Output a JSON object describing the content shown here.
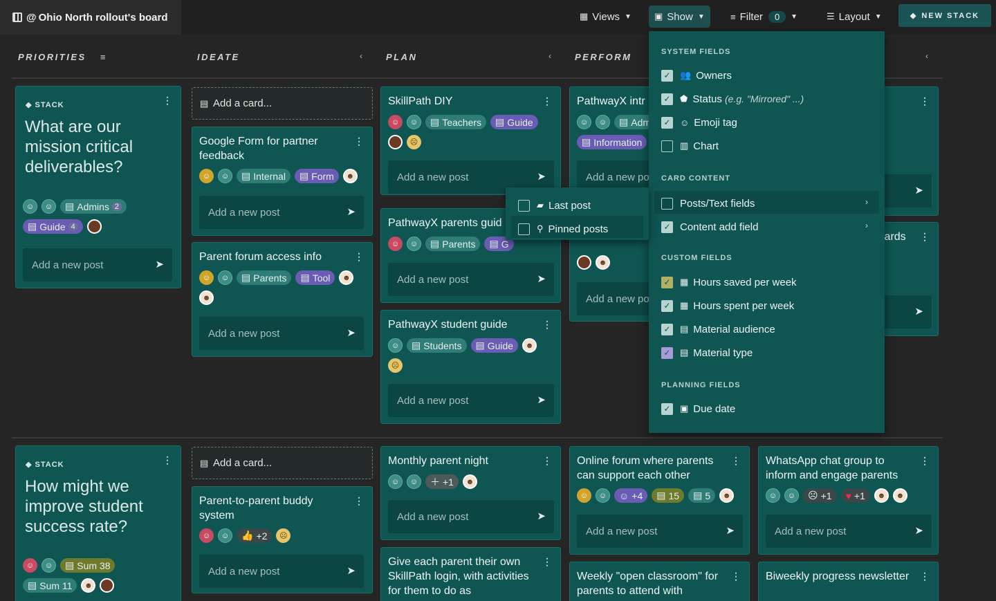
{
  "board": {
    "title": "Ohio North rollout's board"
  },
  "topbar": {
    "views": "Views",
    "show": "Show",
    "filter": "Filter",
    "filter_count": "0",
    "layout": "Layout",
    "new_stack": "NEW STACK"
  },
  "columns": {
    "priorities": "PRIORITIES",
    "ideate": "IDEATE",
    "plan": "PLAN",
    "perform": "PERFORM"
  },
  "common": {
    "add_card": "Add a card...",
    "add_post": "Add a new post",
    "add_post_trunc": "Add a new po",
    "stack_label": "STACK"
  },
  "stacks": [
    {
      "title": "What are our mission critical deliverables?",
      "admins": "Admins",
      "admins_count": "2",
      "guide": "Guide",
      "guide_count": "4"
    },
    {
      "title": "How might we improve student success rate?",
      "sum1": "Sum 38",
      "sum2": "Sum 11"
    }
  ],
  "cards": {
    "google_form": {
      "title": "Google Form for partner feedback",
      "tag1": "Internal",
      "tag2": "Form"
    },
    "parent_forum": {
      "title": "Parent forum access info",
      "tag1": "Parents",
      "tag2": "Tool"
    },
    "skillpath": {
      "title": "SkillPath DIY",
      "tag1": "Teachers",
      "tag2": "Guide"
    },
    "pw_parents": {
      "title": "PathwayX parents guid",
      "tag1": "Parents",
      "tag2": "G"
    },
    "pw_student": {
      "title": "PathwayX student guide",
      "tag1": "Students",
      "tag2": "Guide"
    },
    "pw_intro": {
      "title": "PathwayX intr",
      "tag1": "Adm",
      "tag2": "Information"
    },
    "right_card": {
      "title": "lards"
    },
    "buddy": {
      "title": "Parent-to-parent buddy system",
      "plus": "+2"
    },
    "monthly": {
      "title": "Monthly parent night",
      "plus": "+1"
    },
    "give_each": {
      "title": "Give each parent their own SkillPath login, with activities for them to do as"
    },
    "online_forum": {
      "title": "Online forum where parents can support each other",
      "plus": "+4",
      "n1": "15",
      "n2": "5"
    },
    "whatsapp": {
      "title": "WhatsApp chat group to inform and engage parents",
      "plus1": "+1",
      "plus2": "+1"
    },
    "weekly": {
      "title": "Weekly \"open classroom\" for parents to attend with"
    },
    "biweekly": {
      "title": "Biweekly progress newsletter"
    }
  },
  "show_menu": {
    "system_fields": "SYSTEM FIELDS",
    "owners": "Owners",
    "status": "Status",
    "status_hint": "(e.g. \"Mirrored\" ...)",
    "emoji_tag": "Emoji tag",
    "chart": "Chart",
    "card_content": "CARD CONTENT",
    "posts_text": "Posts/Text fields",
    "content_add": "Content add field",
    "custom_fields": "CUSTOM FIELDS",
    "hours_saved": "Hours saved per week",
    "hours_spent": "Hours spent per week",
    "material_audience": "Material audience",
    "material_type": "Material type",
    "planning_fields": "PLANNING FIELDS",
    "due_date": "Due date"
  },
  "submenu": {
    "last_post": "Last post",
    "pinned_posts": "Pinned posts"
  },
  "colors": {
    "teal_card": "#0f5652",
    "purple_tag": "#6a5bb4",
    "olive_tag": "#6e7a2c",
    "background": "#252525"
  }
}
